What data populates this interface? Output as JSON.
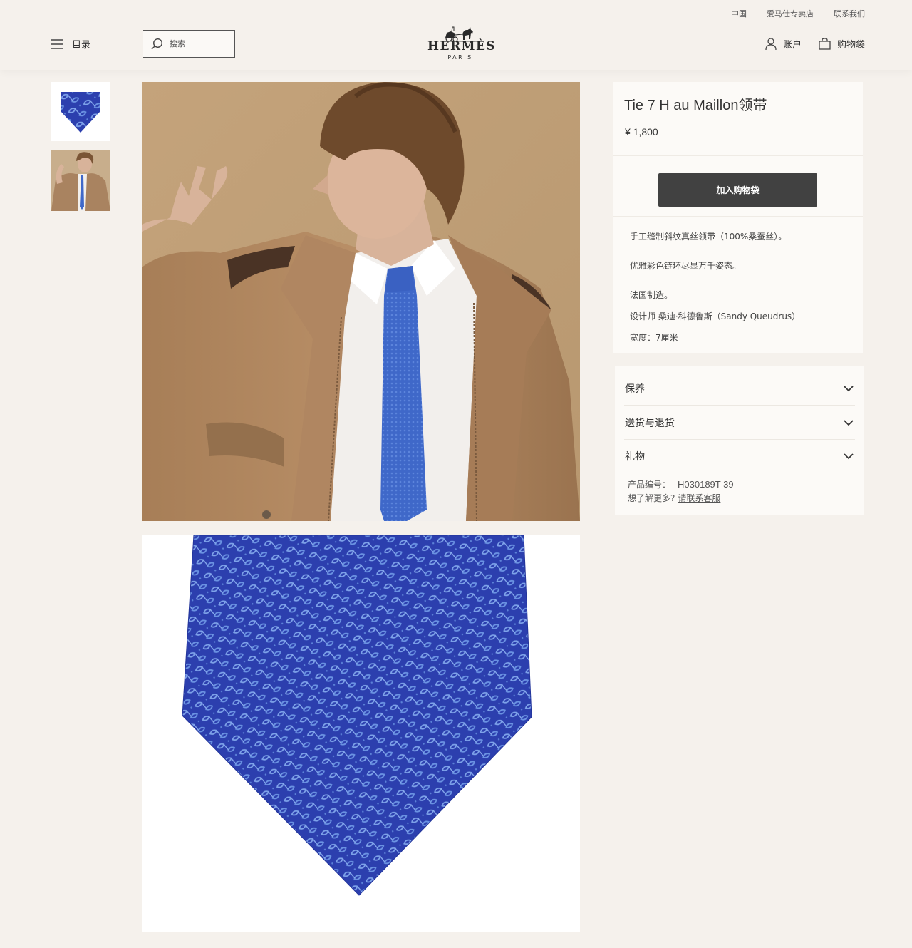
{
  "header": {
    "util_links": [
      "中国",
      "爱马仕专卖店",
      "联系我们"
    ],
    "menu_label": "目录",
    "search_placeholder": "搜索",
    "logo_word": "HERMÈS",
    "logo_city": "PARIS",
    "account_label": "账户",
    "bag_label": "购物袋"
  },
  "product": {
    "title": "Tie 7 H au Maillon领带",
    "price": "¥ 1,800",
    "add_to_bag": "加入购物袋",
    "description": [
      "手工缝制斜纹真丝领带（100%桑蚕丝）。",
      "优雅彩色链环尽显万千姿态。",
      "法国制造。",
      "设计师 桑迪·科德鲁斯（Sandy Queudrus）",
      "宽度：7厘米"
    ],
    "accordion": [
      "保养",
      "送货与退货",
      "礼物"
    ],
    "ref_label": "产品编号：",
    "ref_code": "H030189T 39",
    "more_question": "想了解更多?",
    "more_link": "请联系客服"
  },
  "colors": {
    "background": "#f5f1ec",
    "panel": "#fcfaf7",
    "button": "#414141",
    "tie_blue": "#2f47b3"
  }
}
